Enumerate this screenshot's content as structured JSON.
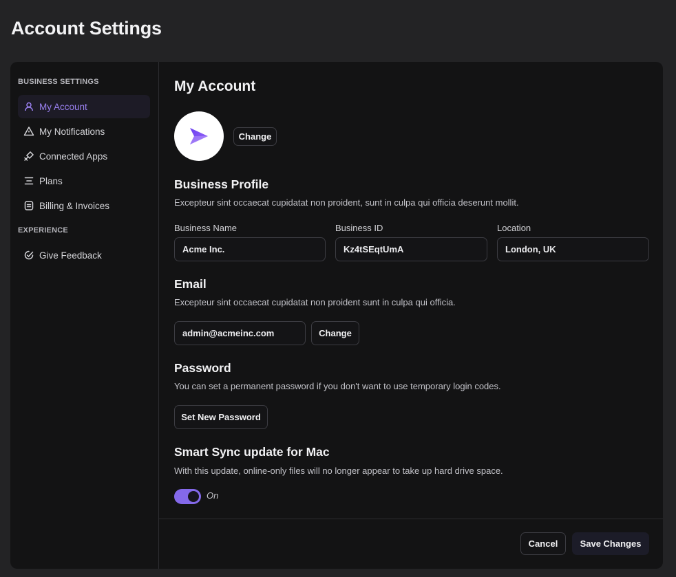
{
  "page": {
    "title": "Account Settings"
  },
  "sidebar": {
    "sections": [
      {
        "label": "BUSINESS SETTINGS"
      },
      {
        "label": "EXPERIENCE"
      }
    ],
    "items": [
      {
        "label": "My Account",
        "icon": "user-icon",
        "active": true
      },
      {
        "label": "My Notifications",
        "icon": "warning-triangle-icon"
      },
      {
        "label": "Connected Apps",
        "icon": "plug-icon"
      },
      {
        "label": "Plans",
        "icon": "list-icon"
      },
      {
        "label": "Billing & Invoices",
        "icon": "receipt-icon"
      },
      {
        "label": "Give Feedback",
        "icon": "check-edit-icon"
      }
    ]
  },
  "main": {
    "title": "My Account",
    "avatar": {
      "icon": "send-arrow-icon",
      "change_label": "Change"
    },
    "business_profile": {
      "title": "Business Profile",
      "description": "Excepteur sint occaecat cupidatat non proident, sunt in culpa qui officia deserunt mollit.",
      "fields": [
        {
          "label": "Business Name",
          "value": "Acme Inc."
        },
        {
          "label": "Business ID",
          "value": "Kz4tSEqtUmA"
        },
        {
          "label": "Location",
          "value": "London, UK"
        }
      ]
    },
    "email": {
      "title": "Email",
      "description": "Excepteur sint occaecat cupidatat non proident sunt in culpa qui officia.",
      "value": "admin@acmeinc.com",
      "change_label": "Change"
    },
    "password": {
      "title": "Password",
      "description": "You can set a permanent password if you don't want to use temporary login codes.",
      "button_label": "Set New Password"
    },
    "smart_sync": {
      "title": "Smart Sync update for Mac",
      "description": "With this update, online-only files will no longer appear to take up hard drive space.",
      "toggle_state": "On",
      "toggle_on": true
    },
    "footer": {
      "cancel_label": "Cancel",
      "save_label": "Save Changes"
    }
  },
  "colors": {
    "accent": "#8469ea",
    "active_text": "#9a80f0",
    "background": "#232325",
    "card": "#131314"
  }
}
